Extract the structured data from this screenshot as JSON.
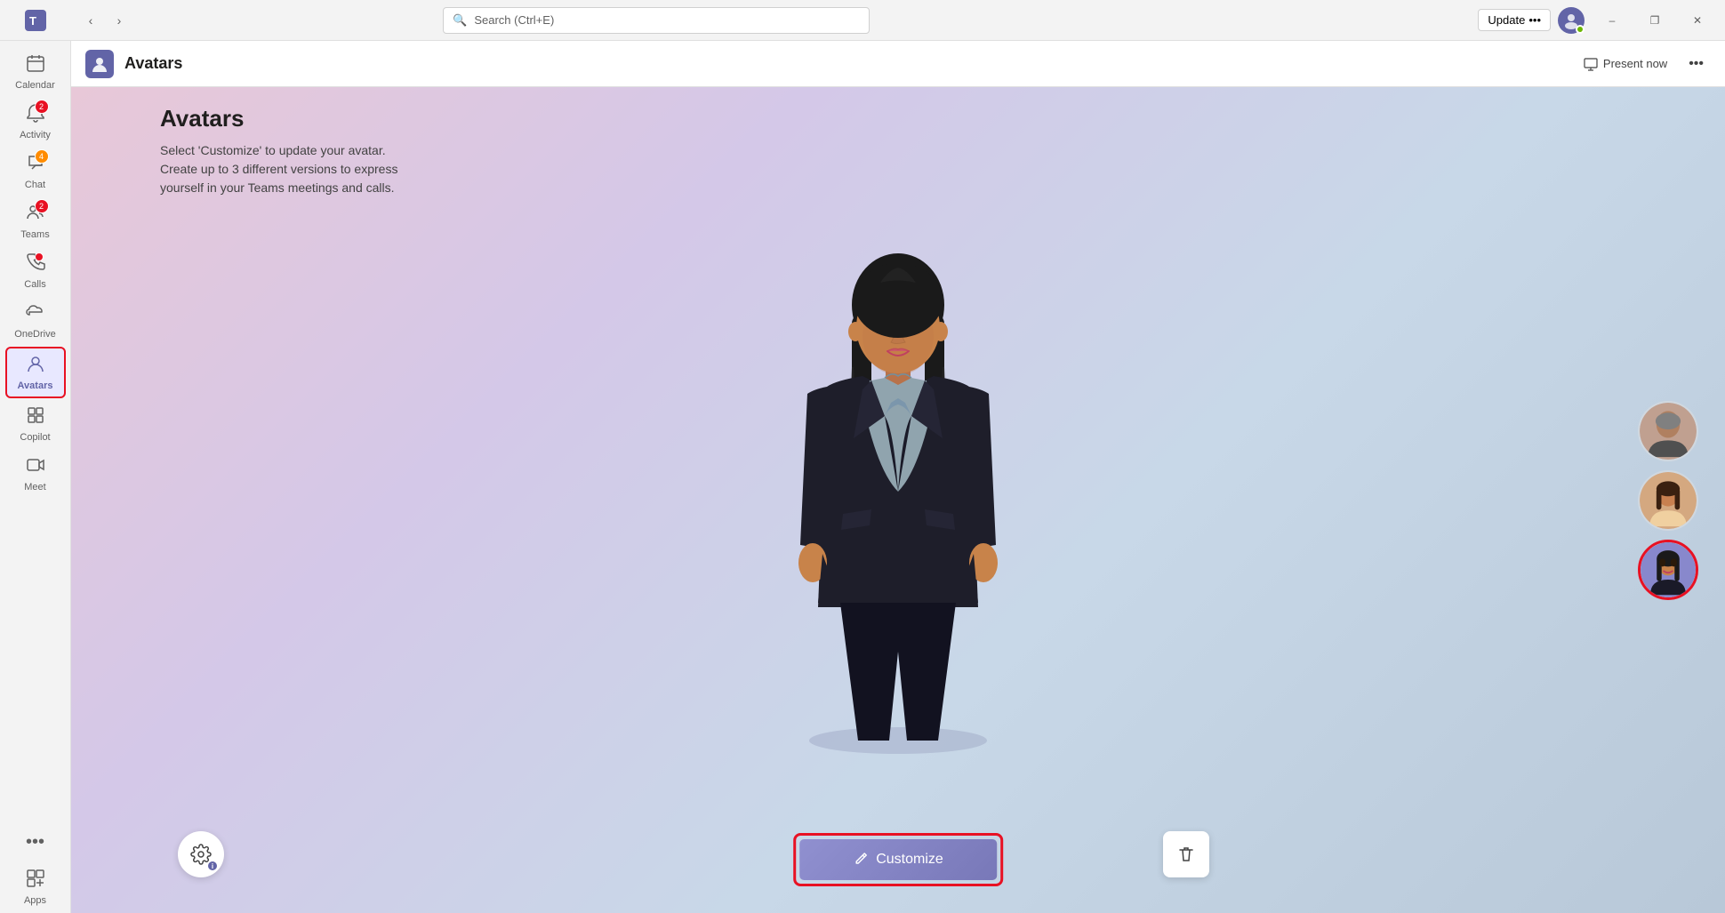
{
  "titlebar": {
    "search_placeholder": "Search (Ctrl+E)",
    "update_label": "Update",
    "update_dots": "•••",
    "minimize_label": "–",
    "maximize_label": "❐",
    "close_label": "✕"
  },
  "sidebar": {
    "items": [
      {
        "id": "calendar",
        "label": "Calendar",
        "icon": "📅",
        "badge": null
      },
      {
        "id": "activity",
        "label": "Activity",
        "icon": "🔔",
        "badge": "2",
        "badge_type": "red"
      },
      {
        "id": "chat",
        "label": "Chat",
        "icon": "💬",
        "badge": "4",
        "badge_type": "orange"
      },
      {
        "id": "teams",
        "label": "Teams",
        "icon": "👥",
        "badge": "2",
        "badge_type": "red"
      },
      {
        "id": "calls",
        "label": "Calls",
        "icon": "📞",
        "badge": "dot",
        "badge_type": "red"
      },
      {
        "id": "onedrive",
        "label": "OneDrive",
        "icon": "☁",
        "badge": null
      },
      {
        "id": "avatars",
        "label": "Avatars",
        "icon": "🧑",
        "badge": null,
        "active": true
      },
      {
        "id": "copilot",
        "label": "Copilot",
        "icon": "⊞",
        "badge": null
      },
      {
        "id": "meet",
        "label": "Meet",
        "icon": "🎥",
        "badge": null
      },
      {
        "id": "apps",
        "label": "Apps",
        "icon": "⊞",
        "badge": null
      }
    ],
    "more_label": "•••"
  },
  "app_header": {
    "title": "Avatars",
    "icon": "🧑",
    "present_label": "Present now",
    "more_label": "•••"
  },
  "content": {
    "title": "Avatars",
    "description_line1": "Select 'Customize' to update your avatar.",
    "description_line2": "Create up to 3 different versions to express",
    "description_line3": "yourself in your Teams meetings and calls."
  },
  "buttons": {
    "customize_label": "Customize",
    "delete_icon": "🗑",
    "settings_icon": "⚙"
  },
  "avatar_panel": {
    "avatar1_bg": "#b0968a",
    "avatar2_bg": "#c8936c",
    "avatar3_bg": "#8888cc"
  },
  "colors": {
    "accent": "#6264a7",
    "active_border": "#e81123",
    "customize_bg": "#8888c8",
    "background_gradient_start": "#e8c8d8",
    "background_gradient_end": "#b8c8d8"
  }
}
